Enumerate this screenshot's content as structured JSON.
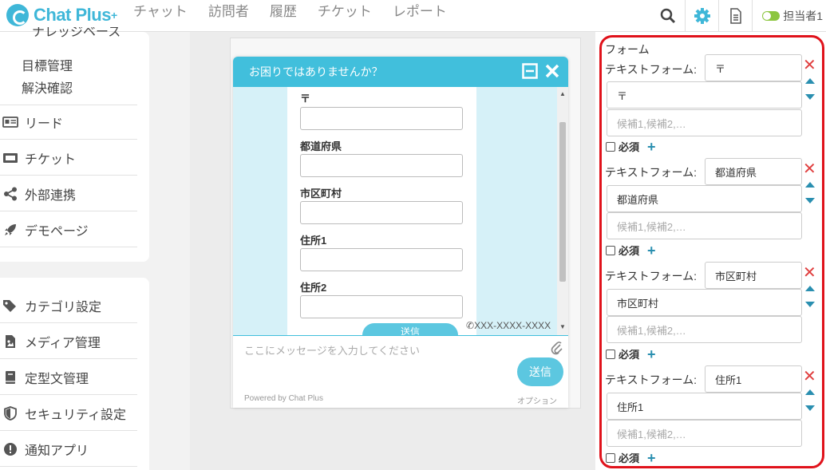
{
  "app": {
    "name": "Chat Plus",
    "plus": "+"
  },
  "nav": [
    "チャット",
    "訪問者",
    "履歴",
    "チケット",
    "レポート"
  ],
  "status": {
    "label": "担当者1"
  },
  "sidebar": {
    "subitems": [
      "ナレッジベース",
      "目標管理",
      "解決確認"
    ],
    "group1": [
      {
        "label": "リード",
        "icon": "id-card-icon"
      },
      {
        "label": "チケット",
        "icon": "ticket-icon"
      },
      {
        "label": "外部連携",
        "icon": "share-icon"
      },
      {
        "label": "デモページ",
        "icon": "rocket-icon"
      }
    ],
    "group2": [
      {
        "label": "カテゴリ設定",
        "icon": "tag-icon"
      },
      {
        "label": "メディア管理",
        "icon": "media-file-icon"
      },
      {
        "label": "定型文管理",
        "icon": "book-icon"
      },
      {
        "label": "セキュリティ設定",
        "icon": "shield-icon"
      },
      {
        "label": "通知アプリ",
        "icon": "alert-icon"
      }
    ]
  },
  "chat": {
    "title": "お困りではありませんか？",
    "fields": [
      "〒",
      "都道府県",
      "市区町村",
      "住所1",
      "住所2"
    ],
    "submit_label": "送信",
    "phone": "XXX-XXXX-XXXX",
    "message_placeholder": "ここにメッセージを入力してください",
    "send_label": "送信",
    "powered_by": "Powered by Chat Plus",
    "option": "オプション"
  },
  "form_panel": {
    "title": "フォーム",
    "items": [
      {
        "type_label": "テキストフォーム:",
        "name": "〒",
        "label_value": "〒",
        "candidates_placeholder": "候補1,候補2,…",
        "required_label": "必須"
      },
      {
        "type_label": "テキストフォーム:",
        "name": "都道府県",
        "label_value": "都道府県",
        "candidates_placeholder": "候補1,候補2,…",
        "required_label": "必須"
      },
      {
        "type_label": "テキストフォーム:",
        "name": "市区町村",
        "label_value": "市区町村",
        "candidates_placeholder": "候補1,候補2,…",
        "required_label": "必須"
      },
      {
        "type_label": "テキストフォーム:",
        "name": "住所1",
        "label_value": "住所1",
        "candidates_placeholder": "候補1,候補2,…",
        "required_label": "必須"
      }
    ]
  },
  "colors": {
    "brand": "#3fb7d8",
    "highlight": "#e0121b",
    "delete": "#e04040",
    "arrow": "#2a8fb0"
  }
}
